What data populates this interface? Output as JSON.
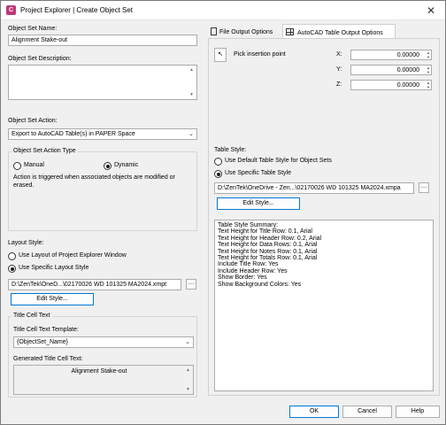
{
  "window": {
    "title": "Project Explorer | Create Object Set",
    "close_glyph": "✕"
  },
  "left": {
    "name_label": "Object Set Name:",
    "name_value": "Alignment Stake-out",
    "desc_label": "Object Set Description:",
    "action_label": "Object Set Action:",
    "action_value": "Export to AutoCAD Table(s) in PAPER Space",
    "action_type_group": "Object Set Action Type",
    "manual_label": "Manual",
    "dynamic_label": "Dynamic",
    "action_note": "Action is triggered when associated objects are modified or erased.",
    "layout_label": "Layout Style:",
    "layout_opt1": "Use Layout of Project Explorer Window",
    "layout_opt2": "Use Specific Layout Style",
    "layout_path": "D:\\ZenTek\\OneD...\\02170026 WD 101325 MA2024.xmpt",
    "edit_style_btn": "Edit Style...",
    "title_cell_group": "Title Cell Text",
    "template_label": "Title Cell Text Template:",
    "template_value": "{ObjectSet_Name}",
    "generated_label": "Generated Title Cell Text:",
    "generated_value": "Alignment Stake-out"
  },
  "tabs": [
    {
      "label": "File Output Options"
    },
    {
      "label": "AutoCAD Table Output Options"
    }
  ],
  "right": {
    "pick_label": "Pick insertion point",
    "x_label": "X:",
    "x_value": "0.00000",
    "y_label": "Y:",
    "y_value": "0.00000",
    "z_label": "Z:",
    "z_value": "0.00000",
    "table_style_label": "Table Style:",
    "style_opt1": "Use Default Table Style for Object Sets",
    "style_opt2": "Use Specific Table Style",
    "style_path": "D:\\ZenTek\\OneDrive - Zen...\\02170026 WD 101325 MA2024.xmpa",
    "edit_style_btn": "Edit Style...",
    "summary": [
      "Table Style Summary:",
      "  Text Height for Title Row: 0.1, Arial",
      "  Text Height for Header Row: 0.2, Arial",
      "  Text Height for Data Rows: 0.1, Arial",
      "  Text Height for Notes Row: 0.1, Arial",
      "  Text Height for Totals Row: 0.1, Arial",
      "  Include Title Row: Yes",
      "  Include Header Row: Yes",
      "  Show Border: Yes",
      "  Show Background Colors: Yes"
    ]
  },
  "footer": {
    "ok": "OK",
    "cancel": "Cancel",
    "help": "Help"
  }
}
